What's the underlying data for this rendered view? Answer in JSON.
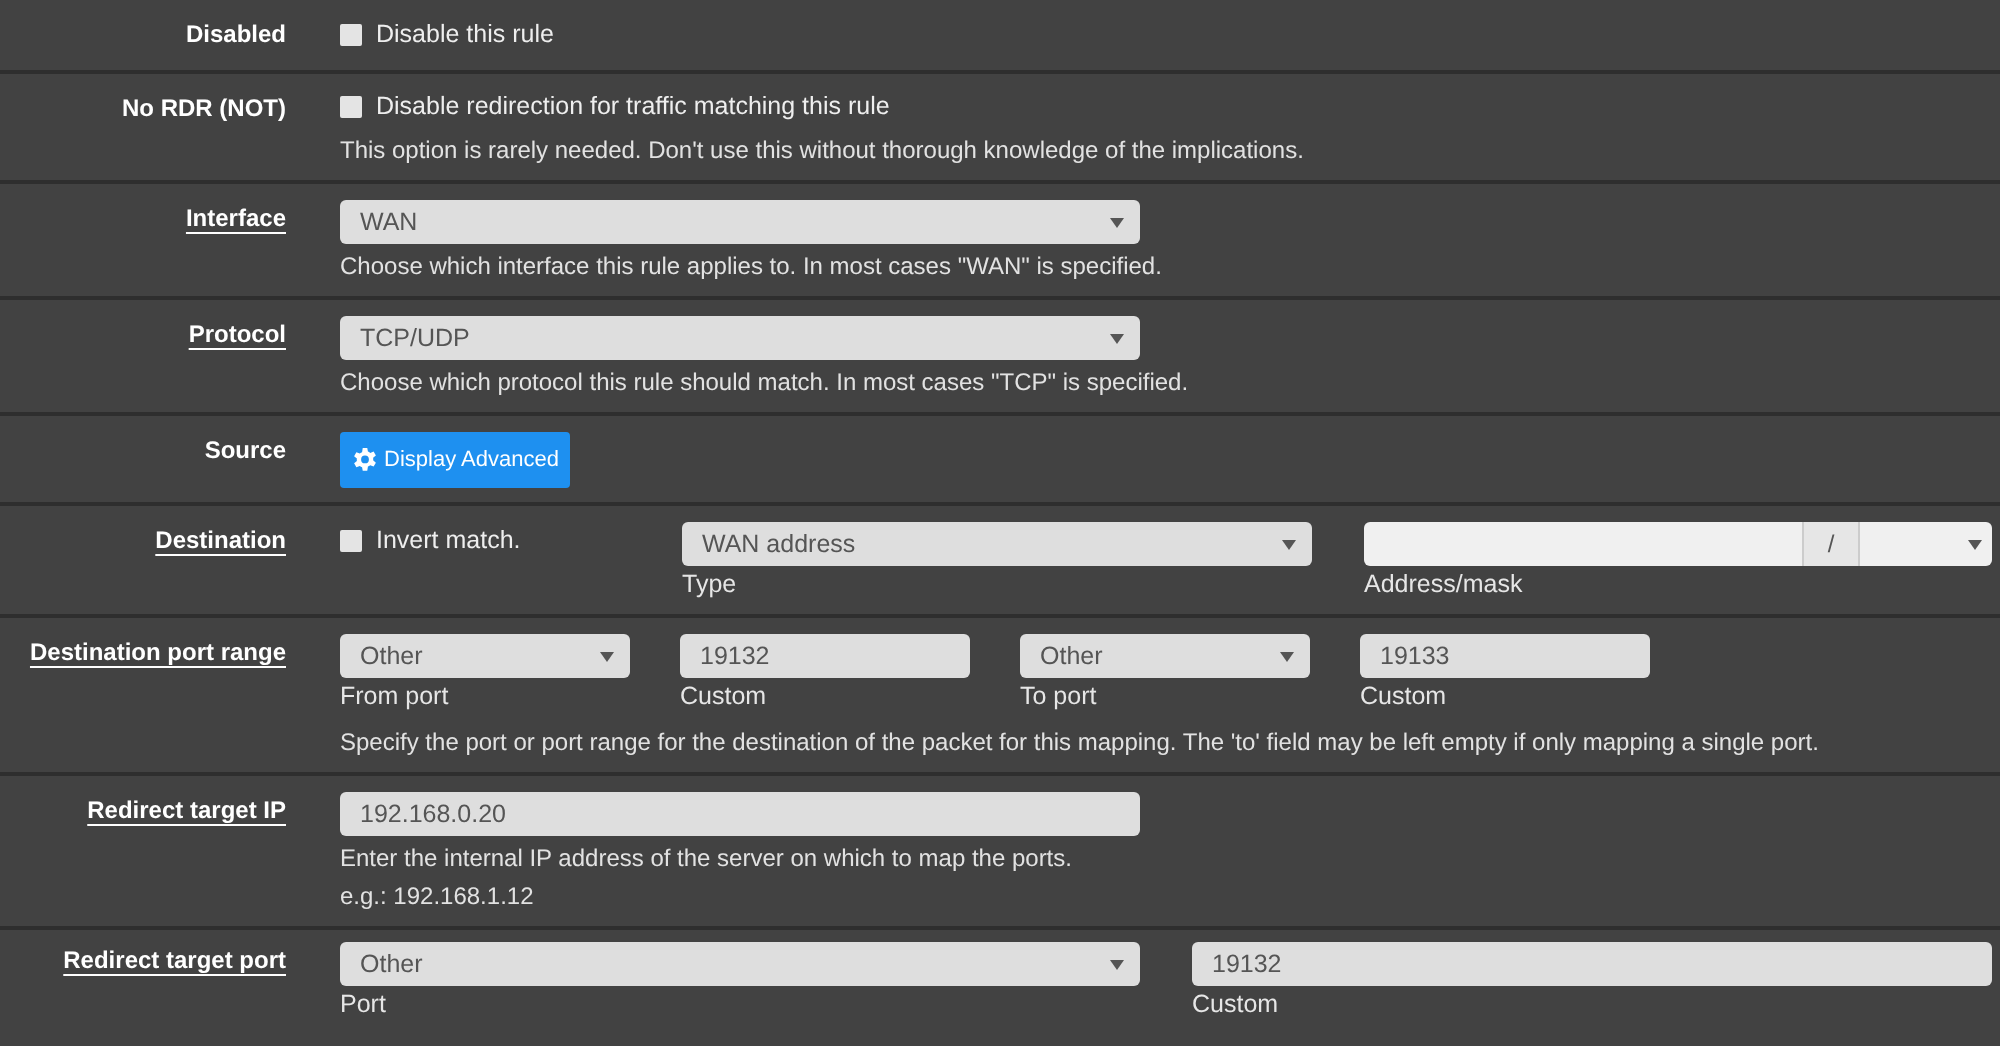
{
  "rows": [
    {
      "label": "Disabled",
      "link": false,
      "fields": [
        {
          "kind": "checkbox",
          "label": "Disable this rule",
          "checked": false
        }
      ]
    },
    {
      "label": "No RDR (NOT)",
      "link": false,
      "fields": [
        {
          "kind": "checkbox",
          "label": "Disable redirection for traffic matching this rule",
          "checked": false
        }
      ],
      "help": [
        "This option is rarely needed. Don't use this without thorough knowledge of the implications."
      ]
    },
    {
      "label": "Interface",
      "link": true,
      "fields": [
        {
          "kind": "select",
          "value": "WAN"
        }
      ],
      "help": [
        "Choose which interface this rule applies to. In most cases \"WAN\" is specified."
      ]
    },
    {
      "label": "Protocol",
      "link": true,
      "fields": [
        {
          "kind": "select",
          "value": "TCP/UDP"
        }
      ],
      "help": [
        "Choose which protocol this rule should match. In most cases \"TCP\" is specified."
      ]
    },
    {
      "label": "Source",
      "link": false,
      "fields": [
        {
          "kind": "button",
          "label": "Display Advanced"
        }
      ]
    },
    {
      "label": "Destination",
      "link": true,
      "fields": [
        {
          "kind": "checkbox",
          "label": "Invert match.",
          "checked": false
        },
        {
          "kind": "select",
          "value": "WAN address",
          "caption": "Type"
        },
        {
          "kind": "address",
          "separator": "/",
          "caption": "Address/mask"
        }
      ]
    },
    {
      "label": "Destination port range",
      "link": true,
      "fields": [
        {
          "kind": "select",
          "value": "Other",
          "caption": "From port"
        },
        {
          "kind": "input",
          "value": "19132",
          "caption": "Custom"
        },
        {
          "kind": "select",
          "value": "Other",
          "caption": "To port"
        },
        {
          "kind": "input",
          "value": "19133",
          "caption": "Custom"
        }
      ],
      "help": [
        "Specify the port or port range for the destination of the packet for this mapping. The 'to' field may be left empty if only mapping a single port."
      ]
    },
    {
      "label": "Redirect target IP",
      "link": true,
      "fields": [
        {
          "kind": "input",
          "value": "192.168.0.20"
        }
      ],
      "help": [
        "Enter the internal IP address of the server on which to map the ports.",
        "e.g.: 192.168.1.12"
      ]
    },
    {
      "label": "Redirect target port",
      "link": true,
      "fields": [
        {
          "kind": "select",
          "value": "Other",
          "caption": "Port"
        },
        {
          "kind": "input",
          "value": "19132",
          "caption": "Custom"
        }
      ]
    }
  ]
}
